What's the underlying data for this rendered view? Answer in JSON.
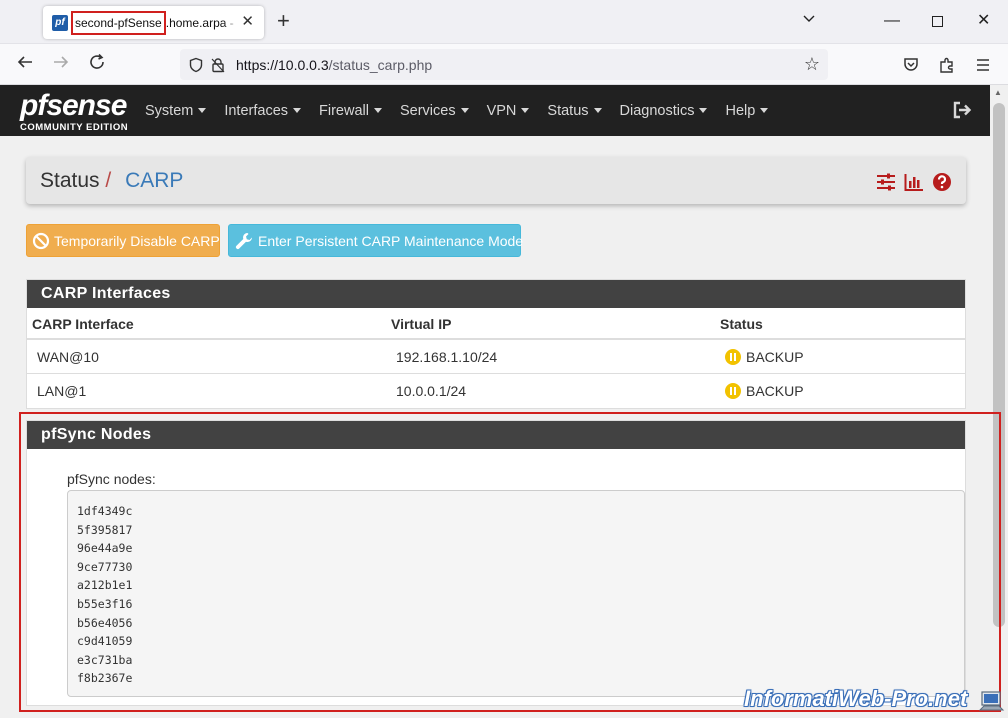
{
  "browser": {
    "tab_title_highlight": "second-pfSense",
    "tab_title_rest": ".home.arpa - Status: CARP",
    "favicon_text": "pf",
    "url_host": "https://10.0.0.3",
    "url_path": "/status_carp.php"
  },
  "header": {
    "logo_main": "pfsense",
    "logo_sub": "COMMUNITY EDITION",
    "menu": [
      "System",
      "Interfaces",
      "Firewall",
      "Services",
      "VPN",
      "Status",
      "Diagnostics",
      "Help"
    ]
  },
  "breadcrumb": {
    "parent": "Status",
    "separator": "/",
    "current": "CARP"
  },
  "actions": {
    "disable_carp": "Temporarily Disable CARP",
    "maintenance_mode": "Enter Persistent CARP Maintenance Mode"
  },
  "carp": {
    "title": "CARP Interfaces",
    "columns": [
      "CARP Interface",
      "Virtual IP",
      "Status"
    ],
    "rows": [
      {
        "interface": "WAN@10",
        "vip": "192.168.1.10/24",
        "status": "BACKUP"
      },
      {
        "interface": "LAN@1",
        "vip": "10.0.0.1/24",
        "status": "BACKUP"
      }
    ]
  },
  "pfsync": {
    "title": "pfSync Nodes",
    "label": "pfSync nodes:",
    "nodes": [
      "1df4349c",
      "5f395817",
      "96e44a9e",
      "9ce77730",
      "a212b1e1",
      "b55e3f16",
      "b56e4056",
      "c9d41059",
      "e3c731ba",
      "f8b2367e"
    ]
  },
  "watermark": "InformatiWeb-Pro.net",
  "colors": {
    "brand_bar": "#212121",
    "warning": "#f0ad4e",
    "info": "#5bc0de",
    "backup_status": "#f2c200",
    "annotation_red": "#d0201e"
  }
}
